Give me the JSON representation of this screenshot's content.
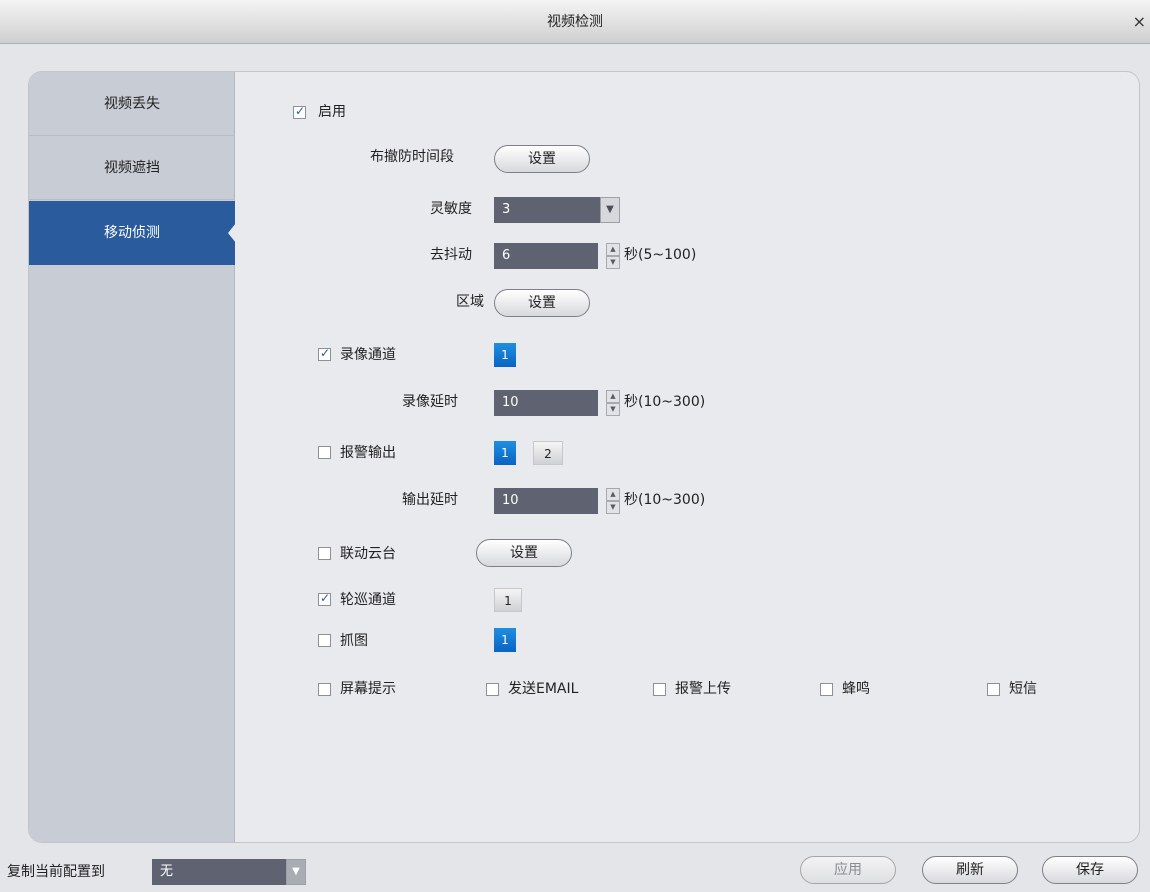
{
  "window": {
    "title": "视频检测",
    "close": "×"
  },
  "sidebar": {
    "items": [
      {
        "label": "视频丢失"
      },
      {
        "label": "视频遮挡"
      },
      {
        "label": "移动侦测",
        "active": true
      }
    ]
  },
  "form": {
    "enable": {
      "label": "启用",
      "checked": true
    },
    "schedule": {
      "label": "布撤防时间段",
      "button": "设置"
    },
    "sensitivity": {
      "label": "灵敏度",
      "value": "3"
    },
    "debounce": {
      "label": "去抖动",
      "value": "6",
      "unit": "秒(5~100)"
    },
    "region": {
      "label": "区域",
      "button": "设置"
    },
    "record_channel": {
      "label": "录像通道",
      "checked": true,
      "chips": [
        "1"
      ]
    },
    "record_delay": {
      "label": "录像延时",
      "value": "10",
      "unit": "秒(10~300)"
    },
    "alarm_output": {
      "label": "报警输出",
      "checked": false,
      "chips": [
        "1",
        "2"
      ]
    },
    "output_delay": {
      "label": "输出延时",
      "value": "10",
      "unit": "秒(10~300)"
    },
    "ptz_link": {
      "label": "联动云台",
      "checked": false,
      "button": "设置"
    },
    "tour_channel": {
      "label": "轮巡通道",
      "checked": true,
      "chips": [
        "1"
      ]
    },
    "snapshot": {
      "label": "抓图",
      "checked": false,
      "chips": [
        "1"
      ]
    },
    "options": [
      {
        "label": "屏幕提示",
        "checked": false
      },
      {
        "label": "发送EMAIL",
        "checked": false
      },
      {
        "label": "报警上传",
        "checked": false
      },
      {
        "label": "蜂鸣",
        "checked": false
      },
      {
        "label": "短信",
        "checked": false
      }
    ]
  },
  "footer": {
    "copy_label": "复制当前配置到",
    "copy_value": "无",
    "apply": "应用",
    "refresh": "刷新",
    "save": "保存"
  },
  "colors": {
    "accent": "#2a5b9c",
    "field": "#5f6270",
    "chip": "#0a63c4"
  },
  "icons": {
    "checkbox": "checkmark-icon",
    "dropdown": "triangle-down-icon",
    "spinner": "up-down-arrows-icon"
  }
}
